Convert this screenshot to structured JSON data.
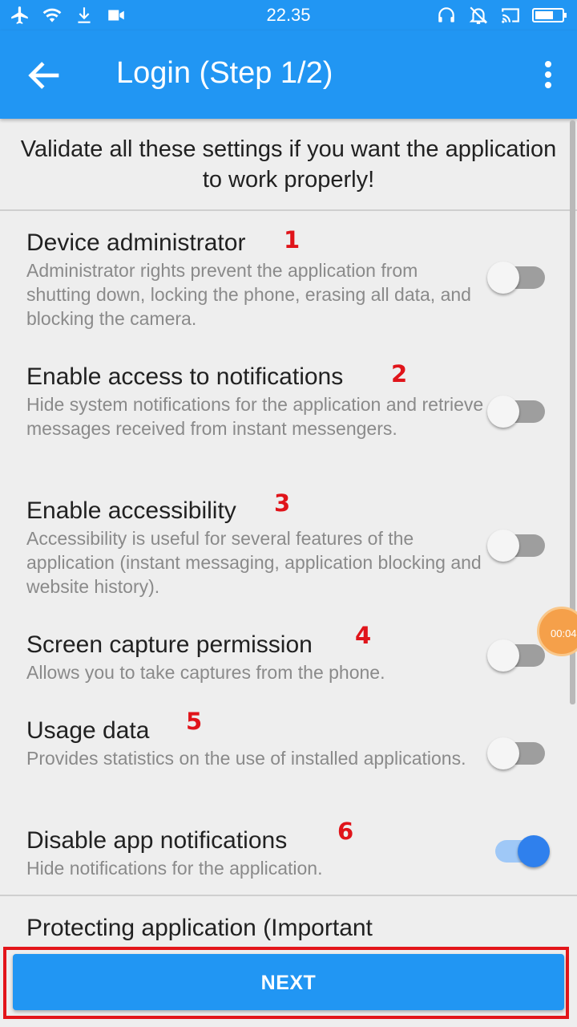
{
  "status_bar": {
    "time": "22.35",
    "left_icons": [
      "airplane-icon",
      "wifi-icon",
      "download-icon",
      "video-icon"
    ],
    "right_icons": [
      "headset-icon",
      "muted-bell-icon",
      "cast-icon",
      "battery-icon"
    ]
  },
  "app_bar": {
    "title": "Login (Step 1/2)",
    "back_icon": "arrow-left-icon",
    "menu_icon": "more-vert-icon",
    "color": "#2196f3"
  },
  "intro_text": "Validate all these settings if you want the application to work properly!",
  "settings": [
    {
      "title": "Device administrator",
      "description": "Administrator rights prevent the application from shutting down, locking the phone, erasing all data, and blocking the camera.",
      "marker": "1",
      "enabled": false
    },
    {
      "title": "Enable access to notifications",
      "description": "Hide system notifications for the application and retrieve messages received from instant messengers.",
      "marker": "2",
      "enabled": false
    },
    {
      "title": "Enable accessibility",
      "description": "Accessibility is useful for several features of the application (instant messaging, application blocking and website history).",
      "marker": "3",
      "enabled": false
    },
    {
      "title": "Screen capture permission",
      "description": "Allows you to take captures from the phone.",
      "marker": "4",
      "enabled": false
    },
    {
      "title": "Usage data",
      "description": "Provides statistics on the use of installed applications.",
      "marker": "5",
      "enabled": false
    },
    {
      "title": "Disable app notifications",
      "description": "Hide notifications for the application.",
      "marker": "6",
      "enabled": true
    },
    {
      "title": "Protecting application (Important"
    }
  ],
  "timer_bubble": "00:04",
  "next_button": "NEXT",
  "colors": {
    "accent": "#2196f3",
    "switch_on": "#2f80ed",
    "marker": "#e0141a",
    "highlight_frame": "#e3151a"
  }
}
